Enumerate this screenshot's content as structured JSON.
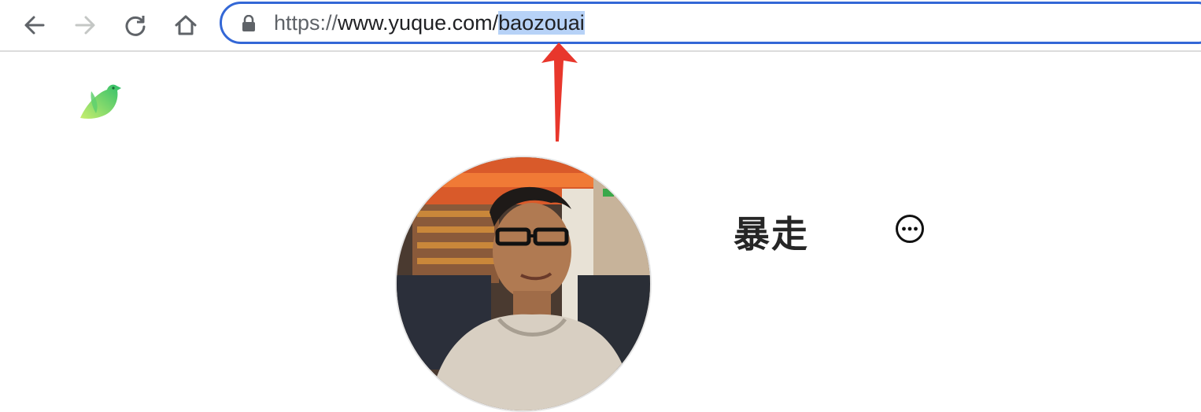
{
  "browser": {
    "url_scheme": "https://",
    "url_host": "www.yuque.com/",
    "url_path_selected": "baozouai",
    "accent_color": "#3367d6",
    "selection_color": "#b7d2f7"
  },
  "nav": {
    "back_icon": "arrow-left-icon",
    "forward_icon": "arrow-right-icon",
    "reload_icon": "reload-icon",
    "home_icon": "home-icon"
  },
  "profile": {
    "name": "暴走",
    "more_icon": "ellipsis-circle-icon",
    "logo_icon": "yuque-bird-logo"
  },
  "annotation": {
    "arrow_color": "#e8372c"
  }
}
